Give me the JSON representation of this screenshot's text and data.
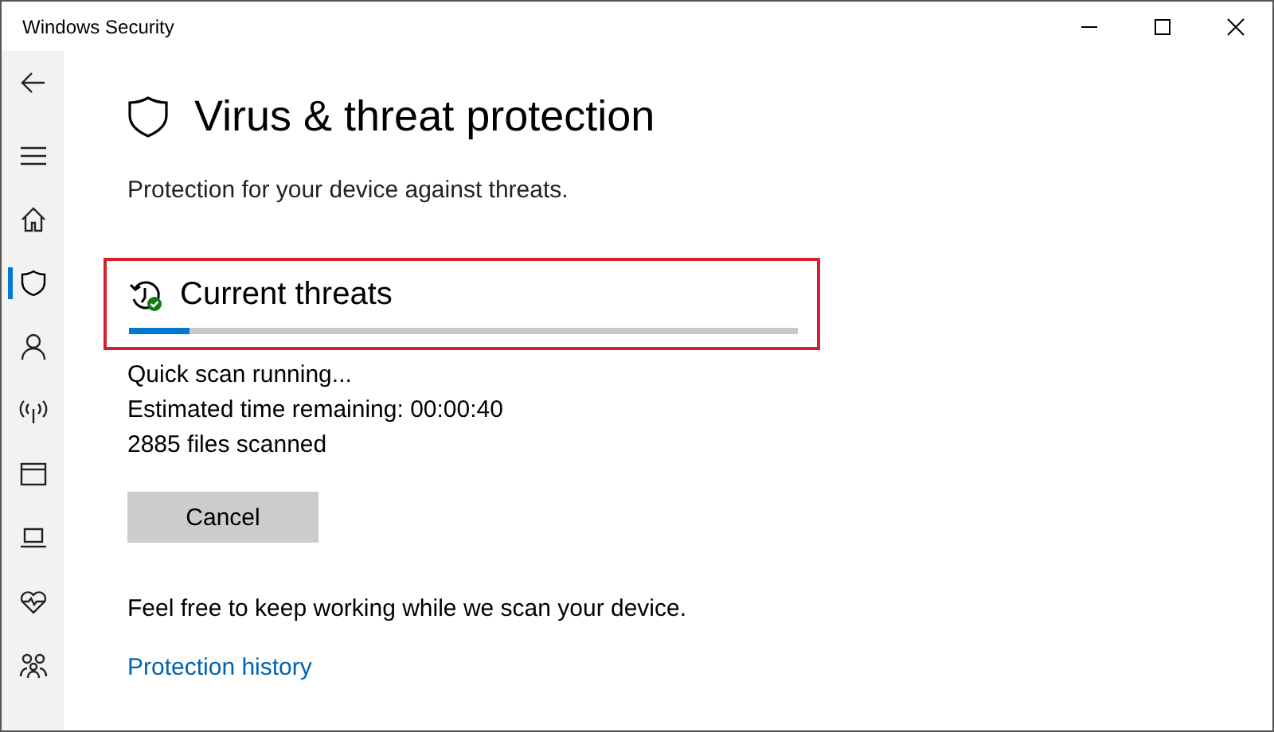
{
  "window": {
    "title": "Windows Security"
  },
  "sidebar": {
    "items": [
      {
        "kind": "back",
        "selected": false
      },
      {
        "kind": "menu",
        "selected": false
      },
      {
        "kind": "home",
        "selected": false
      },
      {
        "kind": "shield",
        "selected": true
      },
      {
        "kind": "person",
        "selected": false
      },
      {
        "kind": "antenna",
        "selected": false
      },
      {
        "kind": "window",
        "selected": false
      },
      {
        "kind": "laptop",
        "selected": false
      },
      {
        "kind": "heart",
        "selected": false
      },
      {
        "kind": "family",
        "selected": false
      }
    ]
  },
  "page": {
    "title": "Virus & threat protection",
    "subtitle": "Protection for your device against threats."
  },
  "current_threats": {
    "heading": "Current threats",
    "progress": {
      "level": 0.09
    },
    "status_lines": [
      "Quick scan running...",
      "Estimated time remaining: 00:00:40",
      "2885  files scanned"
    ],
    "cancel_button": "Cancel"
  },
  "note": "Feel free to keep working while we scan your device.",
  "link": "Protection history"
}
